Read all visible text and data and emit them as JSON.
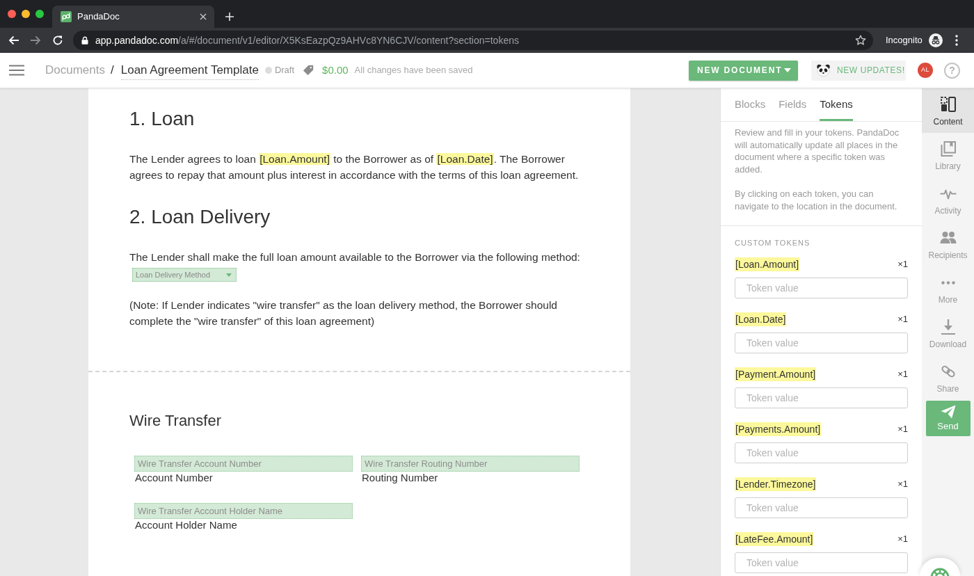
{
  "browser": {
    "tab_title": "PandaDoc",
    "url_host": "app.pandadoc.com",
    "url_path": "/a/#/document/v1/editor/X5KsEazpQz9AHVc8YN6CJV/content?section=tokens",
    "profile": "Incognito"
  },
  "header": {
    "breadcrumb_parent": "Documents",
    "breadcrumb_separator": "/",
    "document_title": "Loan Agreement Template",
    "status": "Draft",
    "price": "$0.00",
    "save_status": "All changes have been saved",
    "new_document_button": "NEW DOCUMENT",
    "updates_button": "NEW UPDATES!",
    "avatar_initials": "AL",
    "help_button": "?"
  },
  "document": {
    "pages": [
      {
        "blocks": [
          {
            "kind": "heading",
            "text": "1. Loan"
          },
          {
            "kind": "paragraph",
            "parts": [
              {
                "text": "The Lender agrees to loan ",
                "token": false
              },
              {
                "text": "[Loan.Amount]",
                "token": true
              },
              {
                "text": " to the Borrower as of ",
                "token": false
              },
              {
                "text": "[Loan.Date]",
                "token": true
              },
              {
                "text": ". The Borrower agrees to repay that amount plus interest in accordance with the terms of this loan agreement.",
                "token": false
              }
            ]
          },
          {
            "kind": "heading",
            "text": "2. Loan Delivery"
          },
          {
            "kind": "paragraph",
            "parts": [
              {
                "text": "The Lender shall make the full loan amount available to the Borrower via the following method:",
                "token": false
              }
            ]
          },
          {
            "kind": "dropdown",
            "placeholder": "Loan Delivery Method"
          },
          {
            "kind": "paragraph",
            "parts": [
              {
                "text": "(Note: If Lender indicates \"wire transfer\" as the loan delivery method, the Borrower should complete the \"wire transfer\" of this loan agreement)",
                "token": false
              }
            ]
          }
        ]
      },
      {
        "blocks": [
          {
            "kind": "subheading",
            "text": "Wire Transfer"
          },
          {
            "kind": "fields",
            "fields": [
              {
                "placeholder": "Wire Transfer Account Number",
                "label": "Account Number"
              },
              {
                "placeholder": "Wire Transfer Routing Number",
                "label": "Routing Number"
              }
            ]
          },
          {
            "kind": "fields",
            "fields": [
              {
                "placeholder": "Wire Transfer Account Holder Name",
                "label": "Account Holder Name"
              }
            ]
          }
        ]
      }
    ]
  },
  "panel": {
    "tabs": [
      {
        "label": "Blocks",
        "selected": false
      },
      {
        "label": "Fields",
        "selected": false
      },
      {
        "label": "Tokens",
        "selected": true
      }
    ],
    "description": [
      "Review and fill in your tokens. PandaDoc will automatically update all places in the document where a specific token was added.",
      "By clicking on each token, you can navigate to the location in the document."
    ],
    "section_title": "CUSTOM TOKENS",
    "tokens": [
      {
        "name": "[Loan.Amount]",
        "count": "×1",
        "placeholder": "Token value"
      },
      {
        "name": "[Loan.Date]",
        "count": "×1",
        "placeholder": "Token value"
      },
      {
        "name": "[Payment.Amount]",
        "count": "×1",
        "placeholder": "Token value"
      },
      {
        "name": "[Payments.Amount]",
        "count": "×1",
        "placeholder": "Token value"
      },
      {
        "name": "[Lender.Timezone]",
        "count": "×1",
        "placeholder": "Token value"
      },
      {
        "name": "[LateFee.Amount]",
        "count": "×1",
        "placeholder": "Token value"
      }
    ]
  },
  "sidebar": {
    "items": [
      {
        "kind": "content",
        "label": "Content",
        "selected": true
      },
      {
        "kind": "library",
        "label": "Library",
        "selected": false
      },
      {
        "kind": "activity",
        "label": "Activity",
        "selected": false
      },
      {
        "kind": "recipients",
        "label": "Recipients",
        "selected": false
      },
      {
        "kind": "more",
        "label": "More",
        "selected": false
      },
      {
        "kind": "download",
        "label": "Download",
        "selected": false
      },
      {
        "kind": "share",
        "label": "Share",
        "selected": false
      }
    ],
    "send_button": "Send"
  }
}
